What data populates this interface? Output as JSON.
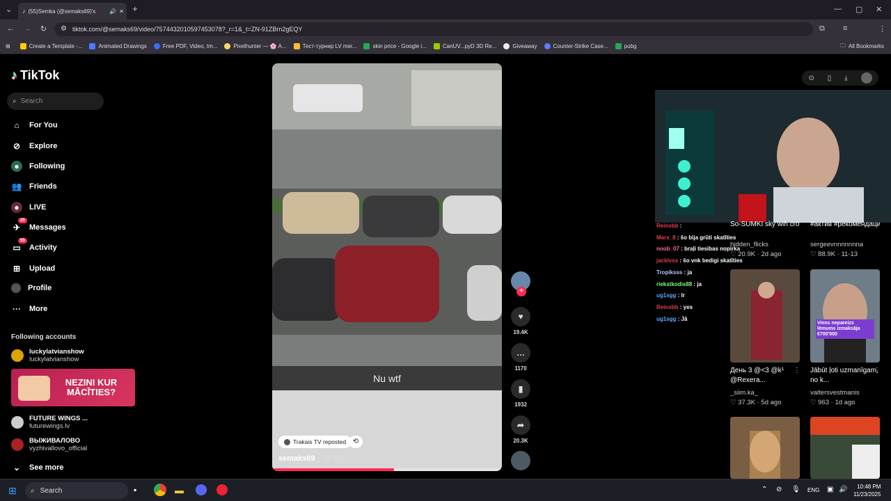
{
  "browser": {
    "tab_title": "(55)Semka (@semaks69)'s",
    "url": "tiktok.com/@semaks69/video/7574432010597453078?_r=1&_t=ZN-91ZBrn2gEQY",
    "bookmarks": [
      "Create a Template -...",
      "Animated Drawings",
      "Free PDF, Video, Im...",
      "Pixelhunter — 🌸 A...",
      "Тест-турнир LV mei...",
      "skin price - Google i...",
      "CanUV...pyD 3D Re...",
      "Giveaway",
      "Counter-Strike Case...",
      "pubg"
    ],
    "all_bookmarks": "All Bookmarks"
  },
  "sidebar": {
    "logo": "TikTok",
    "search_placeholder": "Search",
    "nav": [
      {
        "label": "For You",
        "icon": "home-icon"
      },
      {
        "label": "Explore",
        "icon": "compass-icon"
      },
      {
        "label": "Following",
        "icon": "following-icon"
      },
      {
        "label": "Friends",
        "icon": "friends-icon"
      },
      {
        "label": "LIVE",
        "icon": "live-icon"
      },
      {
        "label": "Messages",
        "icon": "messages-icon",
        "badge": "20"
      },
      {
        "label": "Activity",
        "icon": "activity-icon",
        "badge": "55"
      },
      {
        "label": "Upload",
        "icon": "upload-icon"
      },
      {
        "label": "Profile",
        "icon": "profile-icon"
      },
      {
        "label": "More",
        "icon": "more-icon"
      }
    ],
    "following_title": "Following accounts",
    "accounts": [
      {
        "name": "luckylatvianshow",
        "handle": "luckylatvianshow"
      },
      {
        "name": "FUTURE WINGS ...",
        "handle": "futurewings.lv"
      },
      {
        "name": "ВЫЖИВАЛОВО",
        "handle": "vyzhivallovo_official"
      }
    ],
    "ad_text": "NEZINI KUR MĀCĪTIES?",
    "see_more": "See more"
  },
  "video": {
    "caption": "Nu wtf",
    "reposted": "Trakais TV reposted",
    "author": "semaks69",
    "age": "· 4d ago",
    "progress": 0.53
  },
  "actions": {
    "likes": "19.4K",
    "comments": "1170",
    "saves": "1932",
    "shares": "20.3K"
  },
  "chat": [
    {
      "user": "Reinxbb",
      "msg": ":",
      "color": "#e0404a"
    },
    {
      "user": "Marx_8",
      "msg": ": šo bija grūti skatīties",
      "color": "#e0404a"
    },
    {
      "user": "noob_07",
      "msg": ": braļi tiesibas nopirka",
      "color": "#ff6b9a"
    },
    {
      "user": "jacklvss",
      "msg": ": šo vnk bedigi skatīties",
      "color": "#e0404a"
    },
    {
      "user": "Tropiksss",
      "msg": ": ja",
      "color": "#b7c7ff"
    },
    {
      "user": "riekstkodis88",
      "msg": ": ja",
      "color": "#7fff7f"
    },
    {
      "user": "ug1sgg",
      "msg": ": lr",
      "color": "#5fa8ff"
    },
    {
      "user": "Reinxbb",
      "msg": ": yes",
      "color": "#e0404a"
    },
    {
      "user": "ug1sgg",
      "msg": ": Jā",
      "color": "#5fa8ff"
    }
  ],
  "grid": [
    {
      "title": "So-SUMKI sky wih crowd heart at...",
      "author": "hidden_flicks",
      "likes": "20.9K",
      "age": "2d ago"
    },
    {
      "title": "#актив #рекомендаци...",
      "author": "sergeevnnnnnnna",
      "likes": "88.9K",
      "age": "11-13"
    },
    {
      "title": "День 3 @<3 @k¹ @Rexera...",
      "author": "_siim.ka_",
      "likes": "37.3K",
      "age": "5d ago"
    },
    {
      "title": "Jābūt ļoti uzmanīgam, no k...",
      "author": "valtersvestmanis",
      "likes": "963",
      "age": "1d ago"
    }
  ],
  "card_overlays": [
    "Viens nepareizs lēmums izmaksāja €700'000"
  ],
  "taskbar": {
    "search": "Search",
    "lang": "ENG",
    "time": "10:48 PM",
    "date": "11/23/2025"
  }
}
